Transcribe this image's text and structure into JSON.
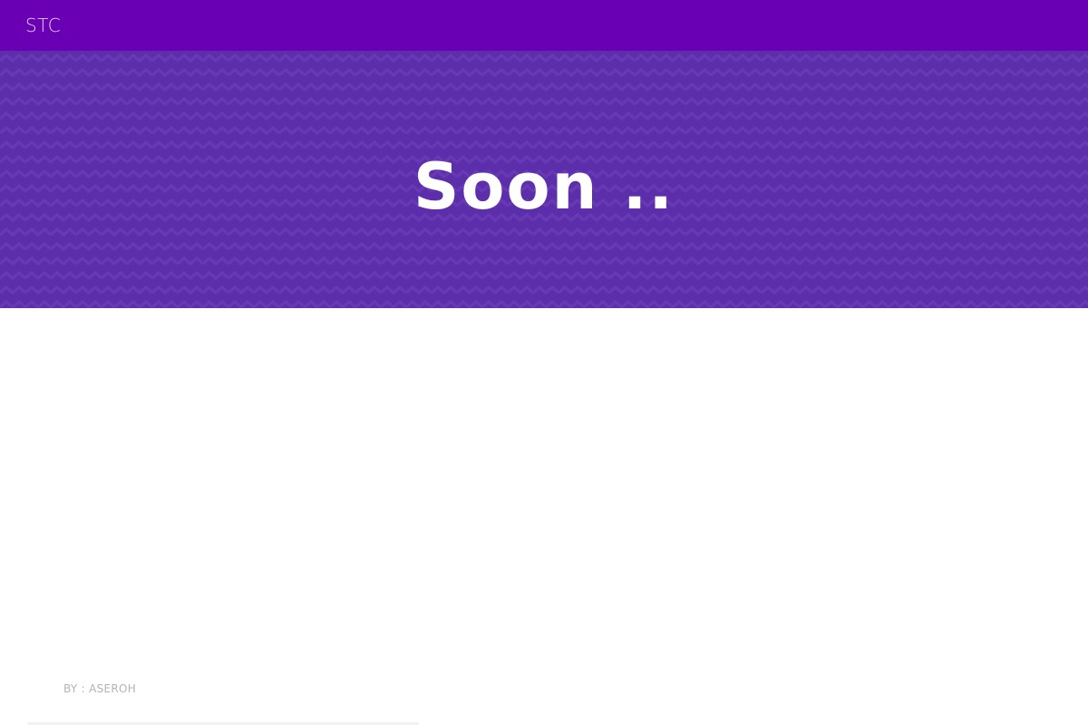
{
  "navbar": {
    "brand": "STC"
  },
  "hero": {
    "title": "Soon .."
  },
  "footer": {
    "credit": "BY : ASEROH"
  },
  "colors": {
    "navbar_background": "#6a00b4",
    "brand_text": "#e4c9ff",
    "hero_background": "#5d2eab",
    "hero_title": "#ffffff",
    "credit_text": "#b3b3b3"
  }
}
